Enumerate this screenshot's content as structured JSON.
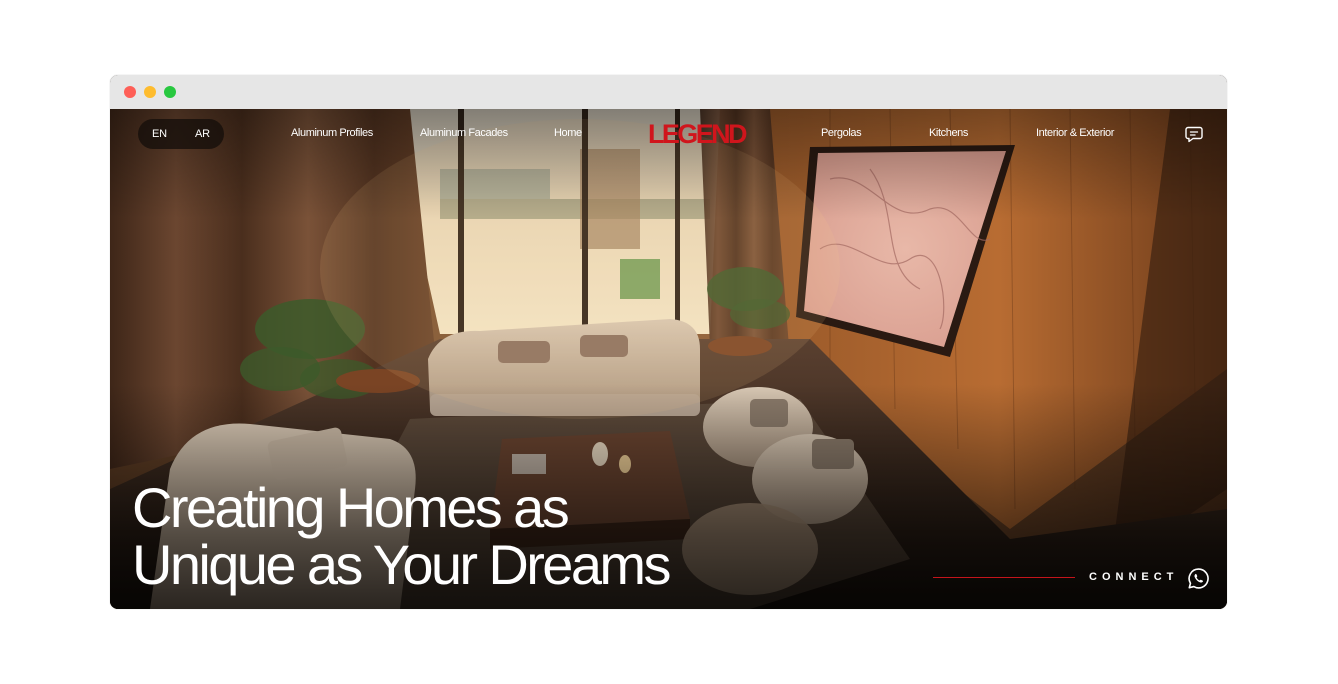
{
  "window": {
    "controls": [
      "close",
      "minimize",
      "maximize"
    ]
  },
  "nav": {
    "languages": [
      "EN",
      "AR"
    ],
    "left_links": [
      "Aluminum Profiles",
      "Aluminum Facades",
      "Home"
    ],
    "logo": "LEGEND",
    "right_links": [
      "Pergolas",
      "Kitchens",
      "Interior & Exterior"
    ],
    "chat_icon": "chat-bubble-icon"
  },
  "hero": {
    "headline_line1": "Creating Homes as",
    "headline_line2": "Unique as Your Dreams",
    "connect_label": "CONNECT",
    "connect_icon": "whatsapp-icon"
  },
  "colors": {
    "brand_red": "#d0151c",
    "accent_line": "#c4141b",
    "titlebar": "#e6e6e6"
  }
}
